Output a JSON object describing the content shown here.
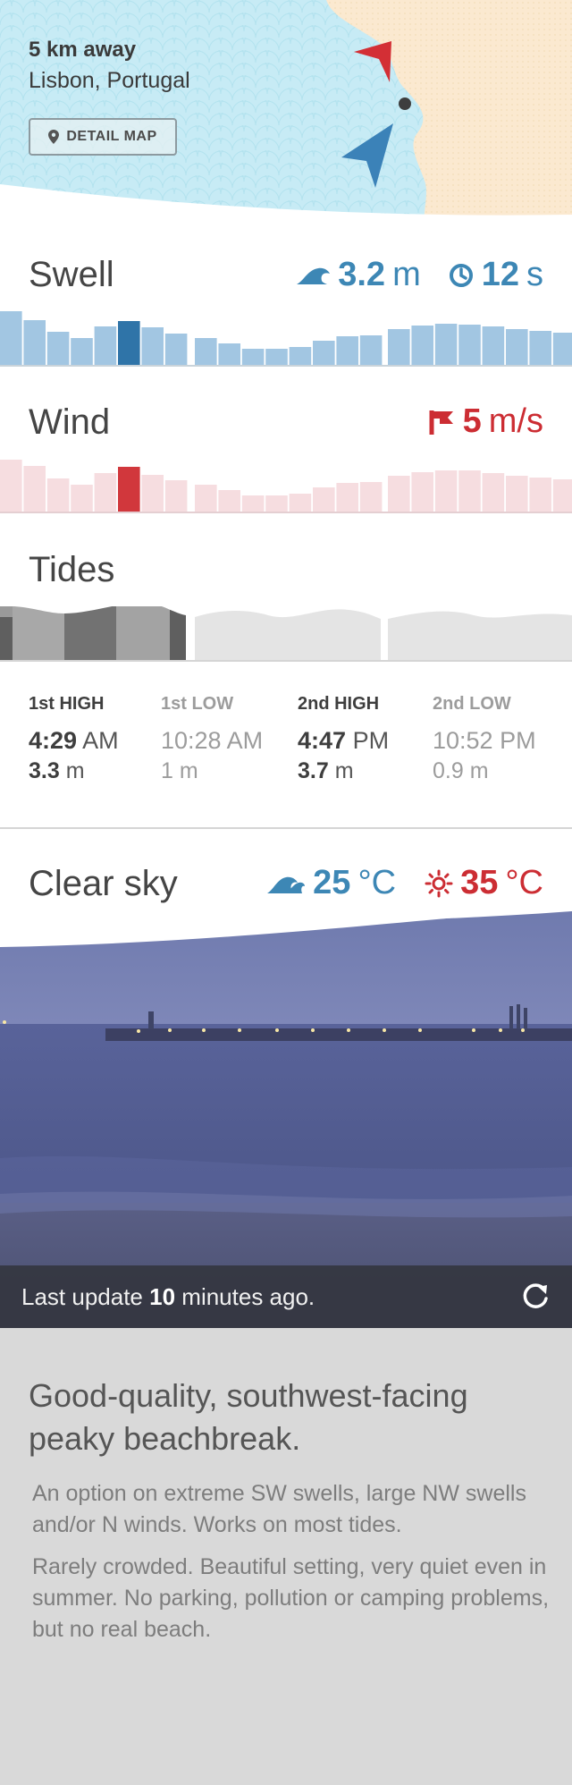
{
  "location": {
    "distance": "5 km away",
    "place": "Lisbon, Portugal",
    "detail_map_label": "DETAIL MAP"
  },
  "swell": {
    "title": "Swell",
    "height_value": "3.2",
    "height_unit": "m",
    "period_value": "12",
    "period_unit": "s",
    "color": "#3d87b5",
    "bar_color": "#a2c6e2",
    "highlight_color": "#2f74a8",
    "levels": [
      0.6,
      0.5,
      0.37,
      0.3,
      0.43,
      0.49,
      0.42,
      0.35,
      0.3,
      0.24,
      0.18,
      0.18,
      0.2,
      0.27,
      0.32,
      0.33,
      0.4,
      0.44,
      0.46,
      0.45,
      0.43,
      0.4,
      0.38,
      0.36
    ],
    "highlight_index": 5
  },
  "wind": {
    "title": "Wind",
    "speed_value": "5",
    "speed_unit": "m/s",
    "color": "#cc2d33",
    "bar_color": "#f6dde0",
    "highlight_color": "#d1373c",
    "levels": [
      0.59,
      0.52,
      0.38,
      0.31,
      0.44,
      0.51,
      0.42,
      0.36,
      0.31,
      0.25,
      0.19,
      0.19,
      0.21,
      0.28,
      0.33,
      0.34,
      0.41,
      0.45,
      0.47,
      0.47,
      0.44,
      0.41,
      0.39,
      0.37
    ],
    "highlight_index": 5
  },
  "tides": {
    "title": "Tides",
    "entries": [
      {
        "label": "1st HIGH",
        "time": "4:29",
        "ampm": "AM",
        "height": "3.3",
        "unit": "m",
        "active": true
      },
      {
        "label": "1st LOW",
        "time": "10:28",
        "ampm": "AM",
        "height": "1",
        "unit": "m",
        "active": false
      },
      {
        "label": "2nd HIGH",
        "time": "4:47",
        "ampm": "PM",
        "height": "3.7",
        "unit": "m",
        "active": true
      },
      {
        "label": "2nd LOW",
        "time": "10:52",
        "ampm": "PM",
        "height": "0.9",
        "unit": "m",
        "active": false
      }
    ]
  },
  "weather": {
    "condition": "Clear sky",
    "water_temp_value": "25",
    "water_temp_unit": "°C",
    "air_temp_value": "35",
    "air_temp_unit": "°C"
  },
  "webcam": {
    "update_prefix": "Last update",
    "update_value": "10",
    "update_suffix": "minutes ago."
  },
  "spot": {
    "headline": "Good-quality, southwest-facing peaky beachbreak.",
    "paragraph_1": "An option on extreme SW swells, large NW swells and/or N winds. Works on most tides.",
    "paragraph_2": "Rarely crowded. Beautiful setting, very quiet even in summer. No parking, pollution or camping problems, but no real beach."
  },
  "icons": {
    "detail_map": "map-pin-icon",
    "swell_height": "wave-icon",
    "swell_period": "clock-icon",
    "wind": "wind-flag-icon",
    "water_temp": "water-wave-icon",
    "air_temp": "sun-icon",
    "refresh": "refresh-icon",
    "location_marker": "location-dot-icon",
    "wind_direction": "wind-direction-arrow-icon",
    "swell_direction": "swell-direction-arrow-icon"
  }
}
